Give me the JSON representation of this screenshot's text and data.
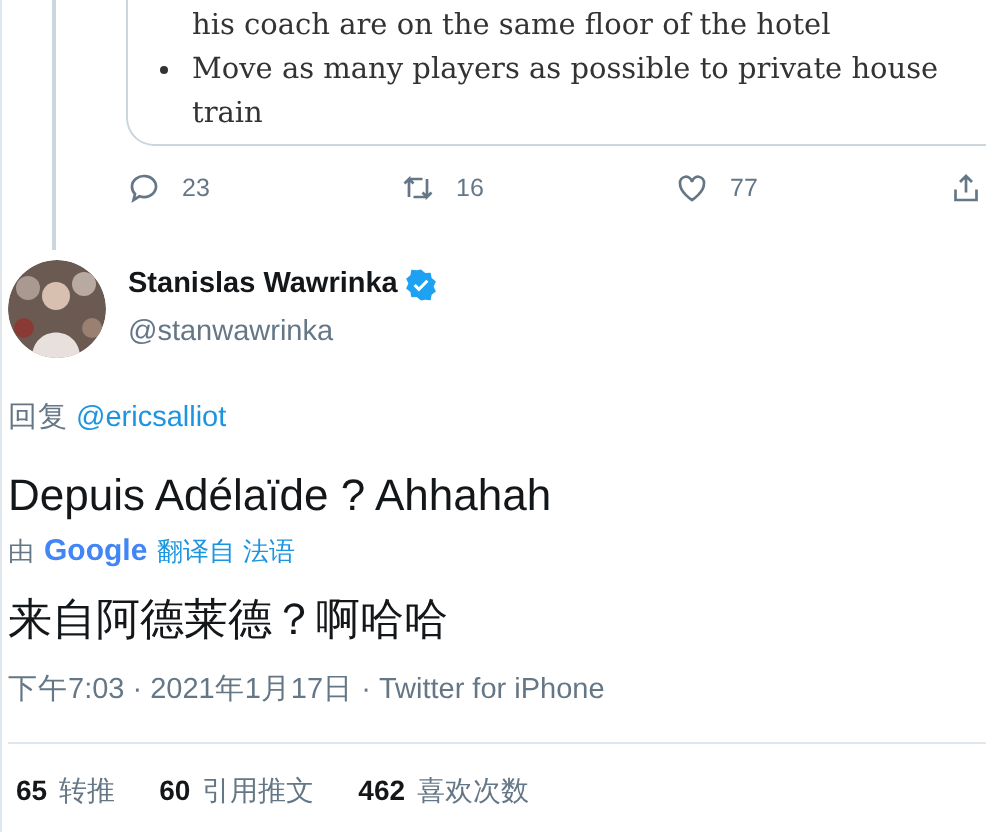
{
  "quoted_card": {
    "bullets": [
      {
        "lines": [
          "his coach are on the same floor of the hotel"
        ]
      },
      {
        "lines": [
          "Move as many players as possible to private house",
          "train"
        ]
      }
    ]
  },
  "thread_actions": [
    {
      "kind": "reply",
      "count": "23"
    },
    {
      "kind": "retweet",
      "count": "16"
    },
    {
      "kind": "like",
      "count": "77"
    },
    {
      "kind": "share"
    }
  ],
  "tweet": {
    "author": {
      "name": "Stanislas Wawrinka",
      "verified": true,
      "handle": "@stanwawrinka"
    },
    "reply_prefix": "回复",
    "reply_to": "@ericsalliot",
    "text": "Depuis Adélaïde ? Ahhahah",
    "translation_by": "由",
    "translation_provider": "Google",
    "translated_from": "翻译自 法语",
    "translated_text": "来自阿德莱德？啊哈哈",
    "meta": "下午7:03 · 2021年1月17日 · Twitter for iPhone",
    "stats": [
      {
        "count": "65",
        "label": "转推"
      },
      {
        "count": "60",
        "label": "引用推文"
      },
      {
        "count": "462",
        "label": "喜欢次数"
      }
    ]
  }
}
